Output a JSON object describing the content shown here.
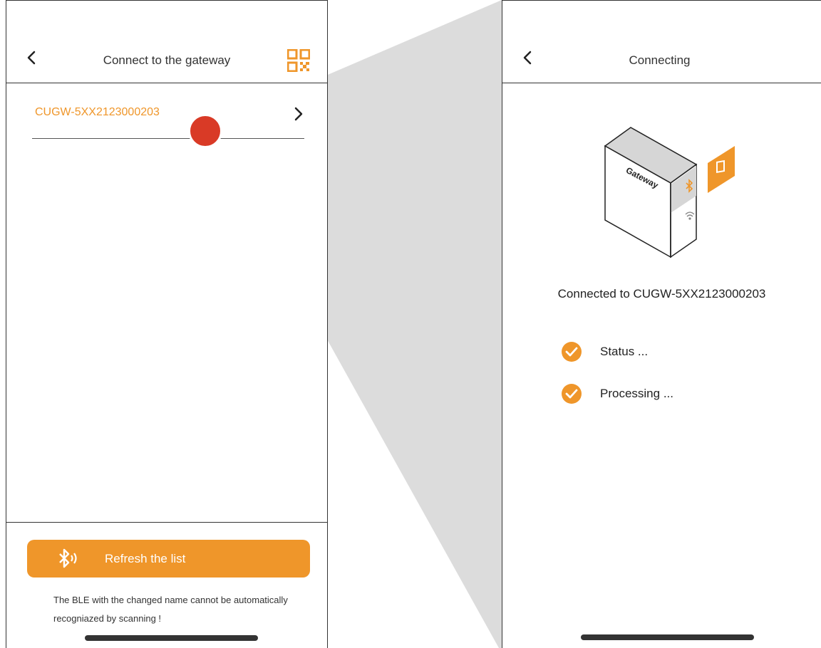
{
  "left_screen": {
    "header": {
      "title": "Connect to the gateway"
    },
    "device_list": [
      {
        "name": "CUGW-5XX2123000203"
      }
    ],
    "refresh_button": {
      "label": "Refresh the list"
    },
    "note": "The BLE with the changed name cannot be automatically recogniazed by scanning !"
  },
  "right_screen": {
    "header": {
      "title": "Connecting"
    },
    "gateway_illustration": {
      "label": "Gateway"
    },
    "connected_text": "Connected to CUGW-5XX2123000203",
    "steps": [
      {
        "label": "Status ...",
        "done": true
      },
      {
        "label": "Processing ...",
        "done": true
      }
    ]
  },
  "colors": {
    "accent": "#ef962a",
    "tap_marker": "#d93a26",
    "zoom_wedge": "#dcdcdc"
  },
  "icons": [
    "back-arrow-icon",
    "qr-code-icon",
    "chevron-right-icon",
    "bluetooth-scan-icon",
    "checkmark-circle-icon",
    "bluetooth-icon",
    "wifi-icon",
    "phone-settings-icon"
  ]
}
